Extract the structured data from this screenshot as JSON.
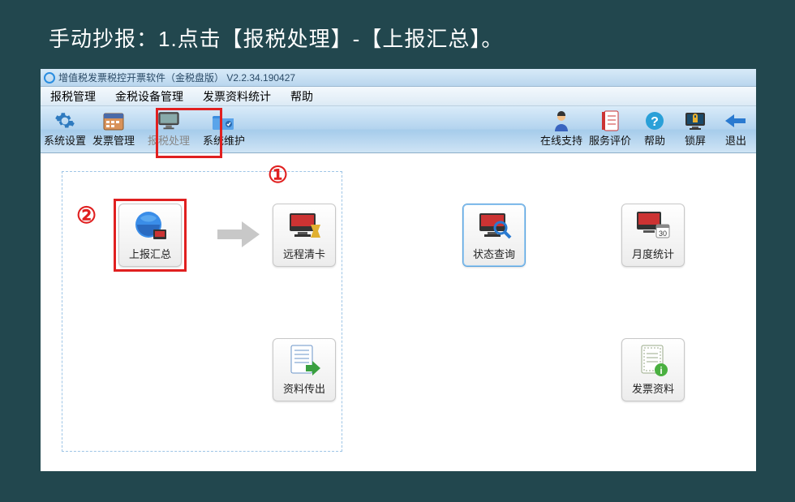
{
  "instruction": "手动抄报：1.点击【报税处理】-【上报汇总】。",
  "titlebar": {
    "title": "增值税发票税控开票软件（金税盘版） V2.2.34.190427"
  },
  "menu": {
    "items": [
      "报税管理",
      "金税设备管理",
      "发票资料统计",
      "帮助"
    ]
  },
  "toolbar": {
    "left": [
      {
        "label": "系统设置",
        "icon": "gear-icon"
      },
      {
        "label": "发票管理",
        "icon": "calendar-icon"
      },
      {
        "label": "报税处理",
        "icon": "monitor-icon",
        "highlighted": true
      },
      {
        "label": "系统维护",
        "icon": "folder-icon"
      }
    ],
    "right": [
      {
        "label": "在线支持",
        "icon": "support-person-icon"
      },
      {
        "label": "服务评价",
        "icon": "notebook-icon"
      },
      {
        "label": "帮助",
        "icon": "help-icon"
      },
      {
        "label": "锁屏",
        "icon": "lock-monitor-icon"
      },
      {
        "label": "退出",
        "icon": "back-arrow-icon"
      }
    ]
  },
  "annotations": {
    "circle1": "①",
    "circle2": "②"
  },
  "content_buttons": {
    "upload_summary": "上报汇总",
    "remote_clear": "远程清卡",
    "status_query": "状态查询",
    "monthly_stats": "月度统计",
    "data_export": "资料传出",
    "invoice_data": "发票资料"
  }
}
